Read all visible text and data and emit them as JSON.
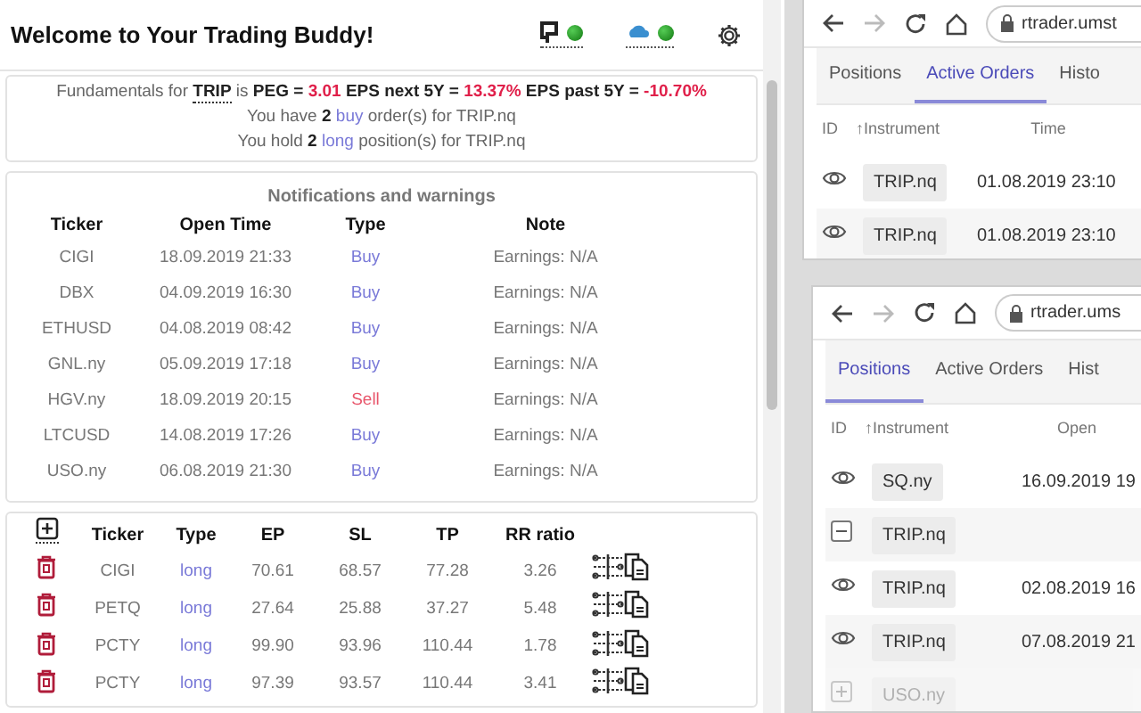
{
  "popup": {
    "title": "Welcome to Your Trading Buddy!",
    "connections": [
      {
        "kind": "platform",
        "online": true
      },
      {
        "kind": "cloud",
        "online": true
      }
    ],
    "fundamentals": [
      [
        {
          "text": "Fundamentals for ",
          "kind": "plain"
        },
        {
          "text": "TRIP",
          "kind": "ticker"
        },
        {
          "text": " is ",
          "kind": "plain"
        },
        {
          "text": "PEG = ",
          "kind": "bold"
        },
        {
          "text": "3.01",
          "kind": "value"
        },
        {
          "text": " EPS next 5Y = ",
          "kind": "bold"
        },
        {
          "text": "13.37%",
          "kind": "value"
        },
        {
          "text": " EPS past 5Y = ",
          "kind": "bold"
        },
        {
          "text": "-10.70%",
          "kind": "value"
        }
      ],
      [
        {
          "text": "You have ",
          "kind": "plain"
        },
        {
          "text": "2 ",
          "kind": "bold"
        },
        {
          "text": "buy",
          "kind": "link"
        },
        {
          "text": " order(s) for TRIP.nq",
          "kind": "plain"
        }
      ],
      [
        {
          "text": "You hold ",
          "kind": "plain"
        },
        {
          "text": "2 ",
          "kind": "bold"
        },
        {
          "text": "long",
          "kind": "link"
        },
        {
          "text": " position(s) for TRIP.nq",
          "kind": "plain"
        }
      ]
    ],
    "notifications": {
      "title": "Notifications and warnings",
      "columns": [
        "Ticker",
        "Open Time",
        "Type",
        "Note"
      ],
      "rows": [
        {
          "ticker": "CIGI",
          "time": "18.09.2019 21:33",
          "type": "Buy",
          "kind": "buy",
          "note": "Earnings: N/A"
        },
        {
          "ticker": "DBX",
          "time": "04.09.2019 16:30",
          "type": "Buy",
          "kind": "buy",
          "note": "Earnings: N/A"
        },
        {
          "ticker": "ETHUSD",
          "time": "04.08.2019 08:42",
          "type": "Buy",
          "kind": "buy",
          "note": "Earnings: N/A"
        },
        {
          "ticker": "GNL.ny",
          "time": "05.09.2019 17:18",
          "type": "Buy",
          "kind": "buy",
          "note": "Earnings: N/A"
        },
        {
          "ticker": "HGV.ny",
          "time": "18.09.2019 20:15",
          "type": "Sell",
          "kind": "sell",
          "note": "Earnings: N/A"
        },
        {
          "ticker": "LTCUSD",
          "time": "14.08.2019 17:26",
          "type": "Buy",
          "kind": "buy",
          "note": "Earnings: N/A"
        },
        {
          "ticker": "USO.ny",
          "time": "06.08.2019 21:30",
          "type": "Buy",
          "kind": "buy",
          "note": "Earnings: N/A"
        }
      ]
    },
    "positions": {
      "columns": [
        "Ticker",
        "Type",
        "EP",
        "SL",
        "TP",
        "RR ratio"
      ],
      "rows": [
        {
          "ticker": "CIGI",
          "type": "long",
          "ep": "70.61",
          "sl": "68.57",
          "tp": "77.28",
          "rr": "3.26"
        },
        {
          "ticker": "PETQ",
          "type": "long",
          "ep": "27.64",
          "sl": "25.88",
          "tp": "37.27",
          "rr": "5.48"
        },
        {
          "ticker": "PCTY",
          "type": "long",
          "ep": "99.90",
          "sl": "93.96",
          "tp": "110.44",
          "rr": "1.78"
        },
        {
          "ticker": "PCTY",
          "type": "long",
          "ep": "97.39",
          "sl": "93.57",
          "tp": "110.44",
          "rr": "3.41"
        }
      ]
    }
  },
  "browsers": [
    {
      "url": "rtrader.umst",
      "tabs": [
        {
          "label": "Positions",
          "selected": false
        },
        {
          "label": "Active Orders",
          "selected": true
        },
        {
          "label": "Histo",
          "selected": false
        }
      ],
      "columns": [
        "ID",
        "↑Instrument",
        "Time"
      ],
      "rows": [
        {
          "kind": "item",
          "instrument": "TRIP.nq",
          "time": "01.08.2019 23:10",
          "dimmed": false
        },
        {
          "kind": "item",
          "instrument": "TRIP.nq",
          "time": "01.08.2019 23:10",
          "dimmed": false
        }
      ]
    },
    {
      "url": "rtrader.ums",
      "tabs": [
        {
          "label": "Positions",
          "selected": true
        },
        {
          "label": "Active Orders",
          "selected": false
        },
        {
          "label": "Hist",
          "selected": false
        }
      ],
      "columns": [
        "ID",
        "↑Instrument",
        "Open"
      ],
      "rows": [
        {
          "kind": "item",
          "instrument": "SQ.ny",
          "time": "16.09.2019 19",
          "dimmed": false
        },
        {
          "kind": "group",
          "instrument": "TRIP.nq",
          "expanded": true,
          "dimmed": false
        },
        {
          "kind": "item",
          "instrument": "TRIP.nq",
          "time": "02.08.2019 16",
          "dimmed": false
        },
        {
          "kind": "item",
          "instrument": "TRIP.nq",
          "time": "07.08.2019 21",
          "dimmed": false
        },
        {
          "kind": "group",
          "instrument": "USO.ny",
          "expanded": false,
          "dimmed": true
        }
      ]
    }
  ]
}
